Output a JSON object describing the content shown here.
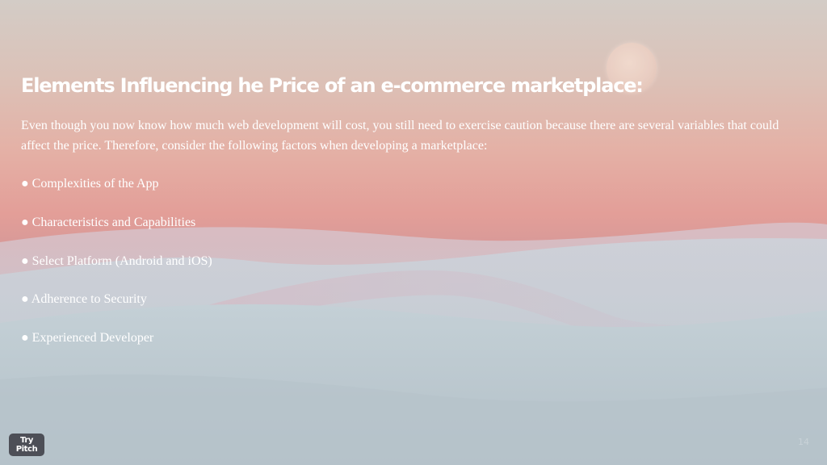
{
  "slide": {
    "title": "Elements Influencing he Price of an e-commerce marketplace:",
    "intro": "Even though you now know how much web development will cost, you still need to exercise caution because there are several variables that could affect the price. Therefore, consider the following factors when developing a marketplace:",
    "bullets": [
      "● Complexities of the App",
      "● Characteristics and Capabilities",
      "● Select Platform (Android and iOS)",
      "● Adherence to Security",
      "● Experienced Developer"
    ],
    "page_number": "14"
  },
  "footer": {
    "try_pitch_label": "Try Pitch"
  }
}
